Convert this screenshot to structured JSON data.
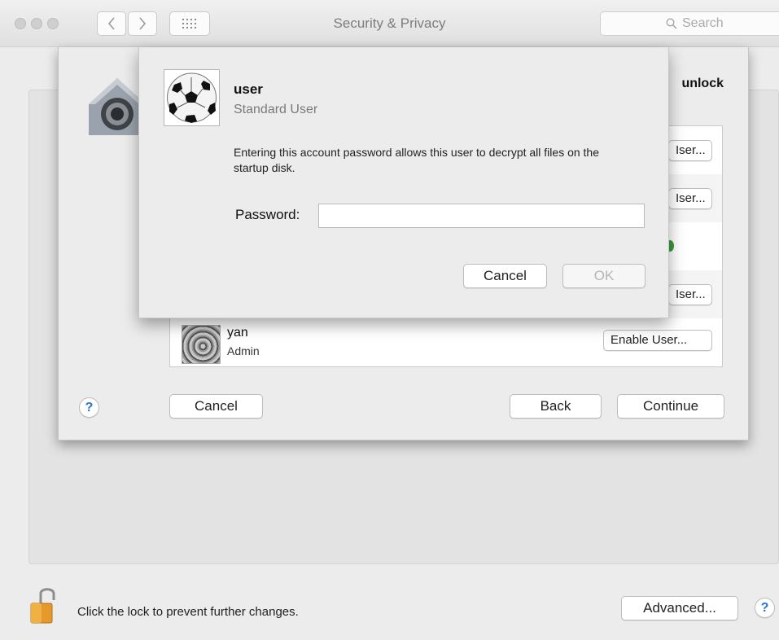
{
  "window": {
    "title": "Security & Privacy",
    "search_placeholder": "Search"
  },
  "sheet": {
    "header_partial": "unlock",
    "users": [
      {
        "button_label": "Iser..."
      },
      {
        "button_label": "Iser..."
      },
      {
        "button_label": ""
      },
      {
        "button_label": "Iser..."
      },
      {
        "name": "yan",
        "role": "Admin",
        "button_label": "Enable User..."
      }
    ],
    "buttons": {
      "help": "?",
      "cancel": "Cancel",
      "back": "Back",
      "continue": "Continue"
    }
  },
  "dialog": {
    "user_name": "user",
    "user_role": "Standard User",
    "message": "Entering this account password allows this user to decrypt all files on the startup disk.",
    "password_label": "Password:",
    "password_value": "",
    "cancel_label": "Cancel",
    "ok_label": "OK"
  },
  "footer": {
    "lock_text": "Click the lock to prevent further changes.",
    "advanced_label": "Advanced...",
    "help": "?"
  },
  "colors": {
    "accent": "#2a74d9",
    "status_green": "#3a9d3a"
  }
}
